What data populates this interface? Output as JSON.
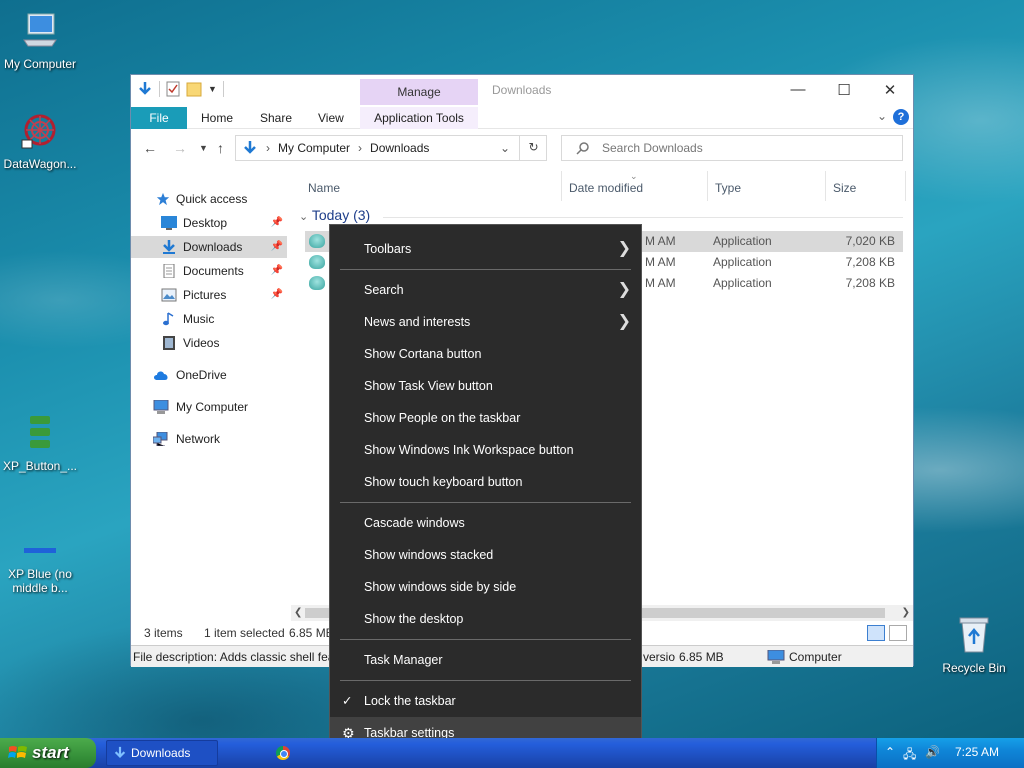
{
  "desktop": {
    "icons": [
      {
        "label": "My Computer"
      },
      {
        "label": "DataWagon..."
      },
      {
        "label": "XP_Button_..."
      },
      {
        "label": "XP Blue (no middle b..."
      },
      {
        "label": "Recycle Bin"
      }
    ]
  },
  "window": {
    "title": "Downloads",
    "manage_label": "Manage",
    "tabs": {
      "file": "File",
      "home": "Home",
      "share": "Share",
      "view": "View",
      "app_tools": "Application Tools"
    },
    "help": "?",
    "address": {
      "segments": [
        "My Computer",
        "Downloads"
      ]
    },
    "search_placeholder": "Search Downloads",
    "nav": [
      {
        "label": "Quick access",
        "icon": "star-icon"
      },
      {
        "label": "Desktop",
        "icon": "desktop-icon",
        "pinned": true
      },
      {
        "label": "Downloads",
        "icon": "download-icon",
        "pinned": true,
        "selected": true
      },
      {
        "label": "Documents",
        "icon": "documents-icon",
        "pinned": true
      },
      {
        "label": "Pictures",
        "icon": "pictures-icon",
        "pinned": true
      },
      {
        "label": "Music",
        "icon": "music-icon"
      },
      {
        "label": "Videos",
        "icon": "videos-icon"
      },
      {
        "label": "OneDrive",
        "icon": "cloud-icon"
      },
      {
        "label": "My Computer",
        "icon": "computer-icon"
      },
      {
        "label": "Network",
        "icon": "network-icon"
      }
    ],
    "columns": {
      "name": "Name",
      "date": "Date modified",
      "type": "Type",
      "size": "Size"
    },
    "group": "Today (3)",
    "rows": [
      {
        "date": "M AM",
        "type": "Application",
        "size": "7,020 KB",
        "selected": true
      },
      {
        "date": "M AM",
        "type": "Application",
        "size": "7,208 KB"
      },
      {
        "date": "M AM",
        "type": "Application",
        "size": "7,208 KB"
      }
    ],
    "status": {
      "items": "3 items",
      "selected": "1 item selected",
      "size": "6.85 MB"
    },
    "details": {
      "description": "File description: Adds classic shell feat",
      "version": "versio",
      "size": "6.85 MB",
      "computer": "Computer"
    }
  },
  "context_menu": {
    "items": [
      {
        "label": "Toolbars",
        "submenu": true
      },
      {
        "label": "Search",
        "submenu": true
      },
      {
        "label": "News and interests",
        "submenu": true
      },
      {
        "label": "Show Cortana button"
      },
      {
        "label": "Show Task View button"
      },
      {
        "label": "Show People on the taskbar"
      },
      {
        "label": "Show Windows Ink Workspace button"
      },
      {
        "label": "Show touch keyboard button"
      },
      {
        "label": "Cascade windows"
      },
      {
        "label": "Show windows stacked"
      },
      {
        "label": "Show windows side by side"
      },
      {
        "label": "Show the desktop"
      },
      {
        "label": "Task Manager"
      },
      {
        "label": "Lock the taskbar",
        "checked": true
      },
      {
        "label": "Taskbar settings",
        "icon": "gear-icon"
      }
    ]
  },
  "taskbar": {
    "start_label": "start",
    "window_button": "Downloads",
    "clock": "7:25 AM"
  }
}
